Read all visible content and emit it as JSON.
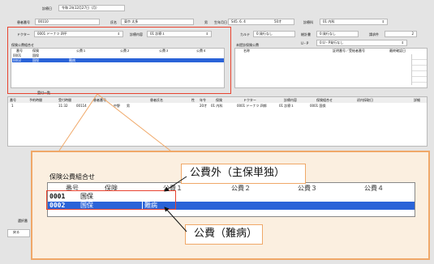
{
  "top": {
    "treatment_date_label": "診療日",
    "treatment_date_value": "令和 2年12月27日（月）"
  },
  "patient": {
    "number_label": "患者番号",
    "number_value": "00110",
    "name_label": "氏名",
    "name_value": "東京 太多",
    "sex": "男",
    "birth_label": "生年月日",
    "birth_value": "S45. 6. 4",
    "age": "50才",
    "dept_label": "診療科",
    "dept_value": "01 内科"
  },
  "filters": {
    "doctor_label": "ドクター",
    "doctor_value": "0001 ドーナツ 四平",
    "detail_label": "診療内容",
    "detail_value": "01 診察１",
    "karte_label": "カルテ",
    "karte_value": "0:発行なし",
    "ledger_label": "総計書",
    "ledger_value": "0:発行なし",
    "count_label": "請求件",
    "count_value": "2",
    "up_label": "U・P",
    "up_value": "0:U・P発行なし"
  },
  "insurance_small": {
    "title": "保険公費組合せ",
    "columns": [
      "番号",
      "保険",
      "公費１",
      "公費２",
      "公費３",
      "公費４"
    ],
    "rows": [
      {
        "no": "0001",
        "ins": "国保",
        "p1": ""
      },
      {
        "no": "0002",
        "ins": "国保",
        "p1": "難病"
      }
    ]
  },
  "shared_insurance": {
    "title": "未提診保険公費",
    "columns": [
      "名称",
      "証明番号／受給者番号",
      "最終確認日"
    ]
  },
  "visits_section": {
    "title": "受付一覧"
  },
  "table": {
    "columns": [
      "番号",
      "予約時間",
      "受付時間",
      "患者番号",
      "患者氏名",
      "性",
      "年令",
      "保険",
      "ドクター",
      "診療内容",
      "保険組合せ",
      "初内採取日",
      "詳細"
    ],
    "rows": [
      [
        "1",
        "",
        "11:32",
        "00114",
        "中野",
        "男",
        "20才",
        "01 内科",
        "0001 ドーナツ 四郎",
        "01 診察１",
        "0001 国保",
        "",
        ""
      ]
    ]
  },
  "bottom": {
    "left_label": "選択番",
    "back_label": "戻る"
  },
  "zoom": {
    "title": "保険公費組合せ",
    "columns": [
      "番号",
      "保険",
      "公費１",
      "公費２",
      "公費３",
      "公費４"
    ],
    "rows": [
      {
        "no": "0001",
        "ins": "国保",
        "p1": ""
      },
      {
        "no": "0002",
        "ins": "国保",
        "p1": "難病"
      }
    ]
  },
  "callouts": {
    "main_only": "公費外（主保単独）",
    "nanbyo": "公費（難病）"
  },
  "colors": {
    "accent_red": "#e8432f",
    "callout_orange": "#f0a868",
    "selection_blue": "#2a63d8"
  }
}
